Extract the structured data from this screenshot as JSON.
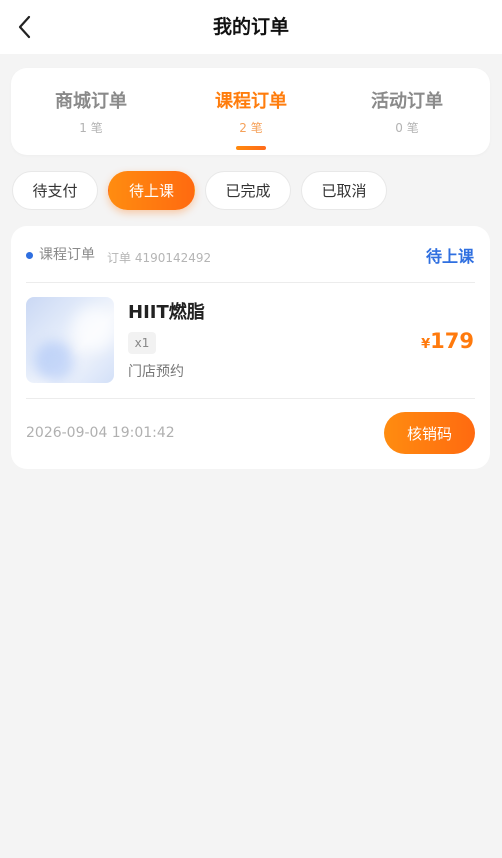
{
  "header": {
    "title": "我的订单",
    "back_icon": "chevron-left-icon"
  },
  "order_types": [
    {
      "label": "商城订单",
      "count": "1 笔",
      "active": false
    },
    {
      "label": "课程订单",
      "count": "2 笔",
      "active": true
    },
    {
      "label": "活动订单",
      "count": "0 笔",
      "active": false
    }
  ],
  "status_filters": [
    {
      "label": "待支付",
      "active": false
    },
    {
      "label": "待上课",
      "active": true
    },
    {
      "label": "已完成",
      "active": false
    },
    {
      "label": "已取消",
      "active": false
    }
  ],
  "orders": [
    {
      "type_label": "课程订单",
      "order_number": "订单 4190142492",
      "status": "待上课",
      "course_name": "HIIT燃脂",
      "quantity": "x1",
      "venue": "门店预约",
      "currency": "¥",
      "price": "179",
      "time": "2026-09-04 19:01:42",
      "action_label": "核销码"
    }
  ],
  "colors": {
    "accent": "#ff7d0d",
    "status_blue": "#2f6fe0",
    "background": "#f4f4f4"
  }
}
